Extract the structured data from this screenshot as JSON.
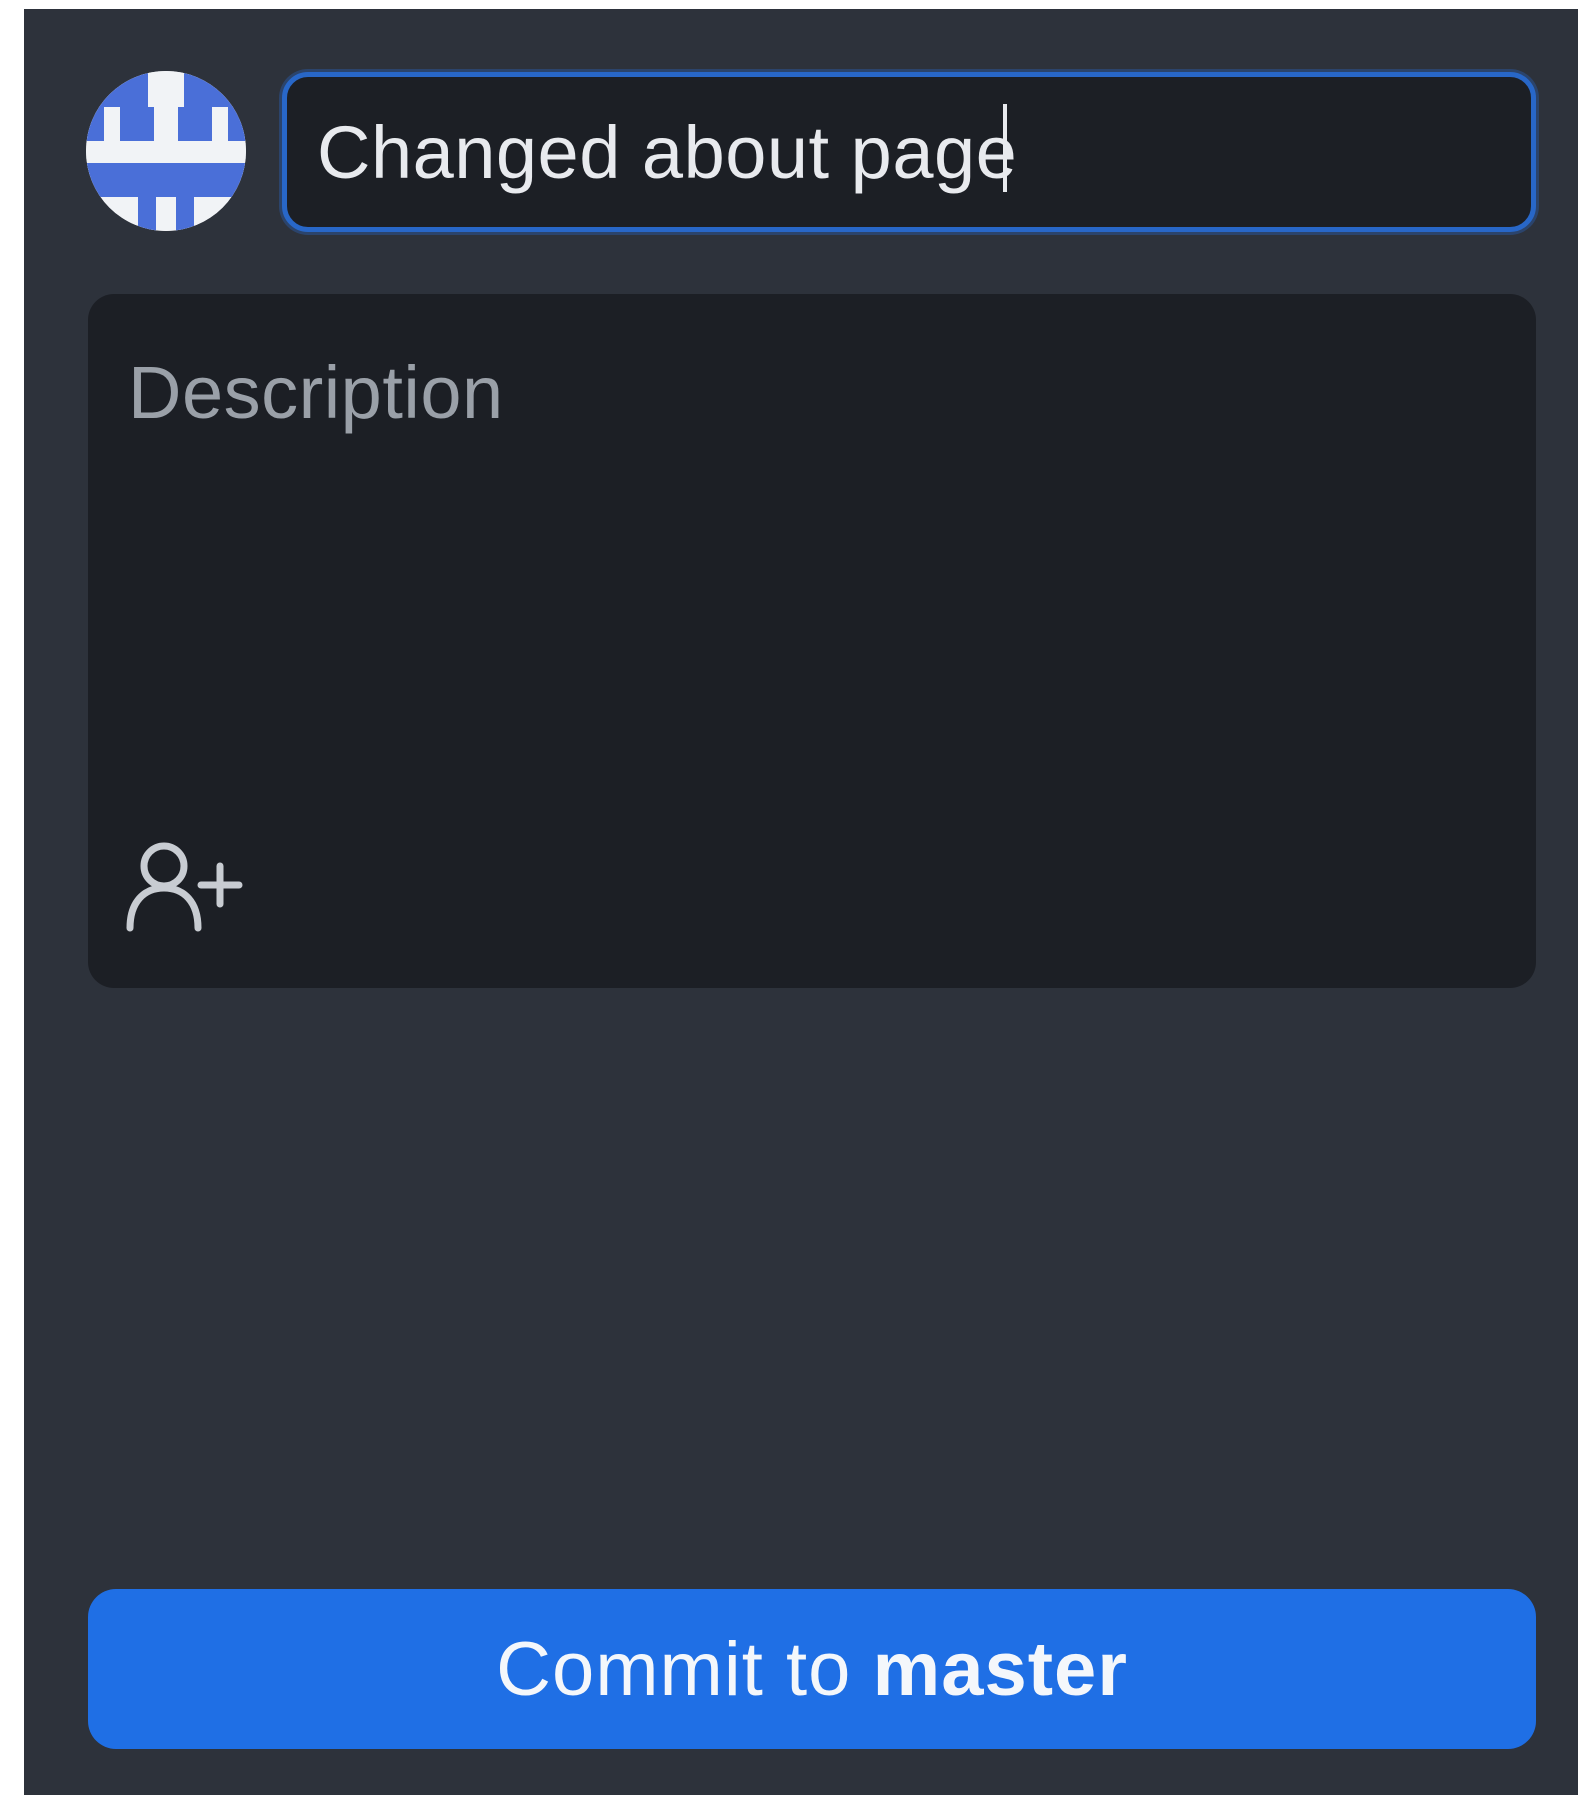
{
  "commit_form": {
    "summary": {
      "value": "Changed about page"
    },
    "description": {
      "placeholder": "Description"
    },
    "coauthor_icon": "add-person-icon",
    "commit_button": {
      "prefix": "Commit to",
      "branch": "master"
    }
  },
  "colors": {
    "panel_background": "#2d323b",
    "input_background": "#1c1f25",
    "focus_border": "#2867c8",
    "button_blue": "#1f6fe5"
  }
}
